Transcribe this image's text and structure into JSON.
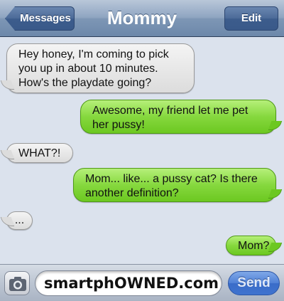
{
  "navbar": {
    "back_label": "Messages",
    "title": "Mommy",
    "edit_label": "Edit"
  },
  "messages": [
    {
      "sender": "them",
      "lines": [
        "Hey honey, I'm coming to pick",
        "you up in about 10 minutes.",
        "How's the playdate going?"
      ]
    },
    {
      "sender": "me",
      "lines": [
        "Awesome, my friend let me pet",
        "her pussy!"
      ]
    },
    {
      "sender": "them",
      "lines": [
        "WHAT?!"
      ]
    },
    {
      "sender": "me",
      "lines": [
        "Mom... like... a pussy cat? Is there",
        "another definition?"
      ]
    },
    {
      "sender": "them",
      "lines": [
        "..."
      ]
    },
    {
      "sender": "me",
      "lines": [
        "Mom?"
      ]
    }
  ],
  "input": {
    "text": "smartphOWNED.com",
    "send_label": "Send",
    "camera_icon": "camera-icon"
  },
  "colors": {
    "incoming_bubble": "#dcdcdc",
    "outgoing_bubble": "#86d83e",
    "background": "#dbe2ed",
    "navbar": "#7d96b5",
    "send_button": "#4f80d6"
  }
}
